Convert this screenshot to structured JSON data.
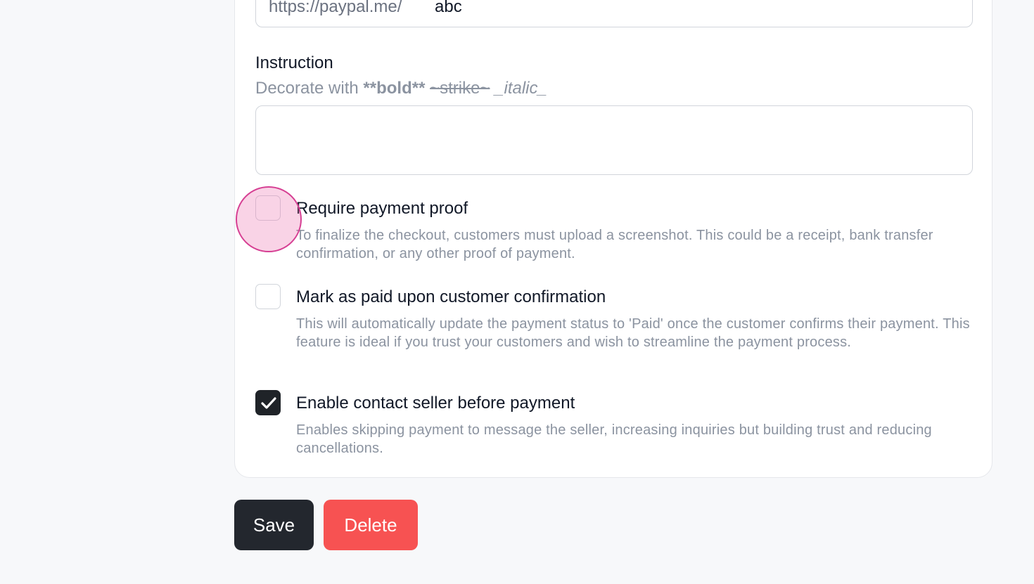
{
  "payment_link": {
    "prefix": "https://paypal.me/",
    "value": "abc"
  },
  "instruction": {
    "title": "Instruction",
    "hint_prefix": "Decorate with ",
    "hint_bold": "**bold**",
    "hint_strike": "~strike~",
    "hint_italic": "_italic_",
    "value": ""
  },
  "options": [
    {
      "title": "Require payment proof",
      "description": "To finalize the checkout, customers must upload a screenshot. This could be a receipt, bank transfer confirmation, or any other proof of payment.",
      "checked": false
    },
    {
      "title": "Mark as paid upon customer confirmation",
      "description": "This will automatically update the payment status to 'Paid' once the customer confirms their payment. This feature is ideal if you trust your customers and wish to streamline the payment process.",
      "checked": false
    },
    {
      "title": "Enable contact seller before payment",
      "description": "Enables skipping payment to message the seller, increasing inquiries but building trust and reducing cancellations.",
      "checked": true
    }
  ],
  "actions": {
    "save_label": "Save",
    "delete_label": "Delete"
  },
  "colors": {
    "save_bg": "#23272e",
    "delete_bg": "#f75252",
    "highlight": "#d63f93"
  }
}
